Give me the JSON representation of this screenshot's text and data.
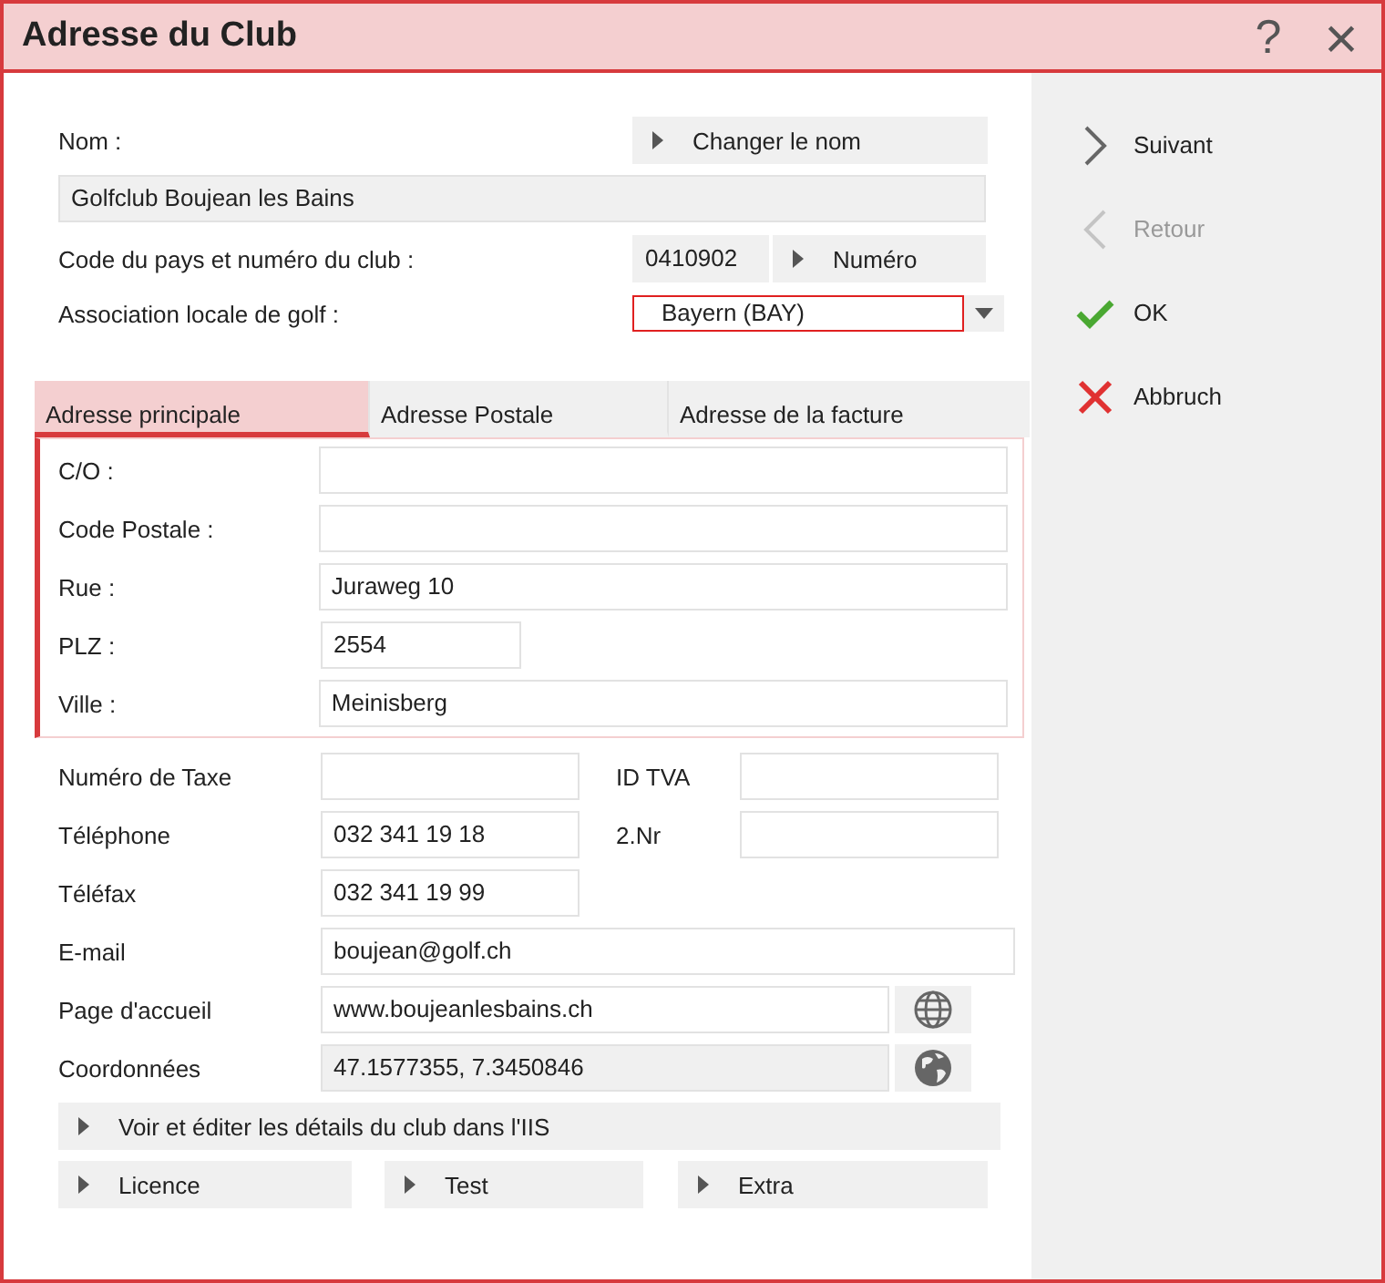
{
  "window": {
    "title": "Adresse du Club",
    "help": "?",
    "close": "×"
  },
  "name": {
    "label": "Nom :",
    "button": "Changer le nom",
    "value": "Golfclub Boujean les Bains"
  },
  "club_code": {
    "label": "Code du pays et numéro du club :",
    "value": "0410902",
    "button": "Numéro"
  },
  "association": {
    "label": "Association locale de golf :",
    "value": "Bayern (BAY)"
  },
  "tabs": [
    {
      "label": "Adresse principale",
      "selected": true
    },
    {
      "label": "Adresse Postale",
      "selected": false
    },
    {
      "label": "Adresse de la facture",
      "selected": false
    }
  ],
  "address_fields": [
    {
      "label": "C/O :",
      "kind": "wide"
    },
    {
      "label": "Code Postale :",
      "kind": "wide"
    },
    {
      "label": "Rue :",
      "value": "Juraweg 10",
      "kind": "wide"
    },
    {
      "label": "PLZ :",
      "value": "2554",
      "kind": "short"
    },
    {
      "label": "Ville :",
      "value": "Meinisberg",
      "kind": "wide"
    }
  ],
  "contact_rows": [
    {
      "fields": [
        {
          "label": "Numéro de Taxe",
          "kind": "short"
        },
        {
          "label": "ID TVA",
          "kind": "short"
        }
      ]
    },
    {
      "fields": [
        {
          "label": "Téléphone",
          "value": "032 341 19 18",
          "kind": "short"
        },
        {
          "label": "2.Nr",
          "kind": "short"
        }
      ]
    },
    {
      "fields": [
        {
          "label": "Téléfax",
          "value": "032 341 19 99",
          "kind": "short"
        }
      ]
    },
    {
      "fields": [
        {
          "label": "E-mail",
          "value": "boujean@golf.ch",
          "kind": "wide"
        }
      ]
    },
    {
      "fields": [
        {
          "label": "Page d'accueil",
          "value": "www.boujeanlesbains.ch",
          "kind": "web"
        }
      ]
    },
    {
      "fields": [
        {
          "label": "Coordonnées",
          "value": "47.1577355, 7.3450846",
          "kind": "geo"
        }
      ]
    }
  ],
  "iis_button": "Voir et éditer les détails du club dans l'IIS",
  "bottom_buttons": [
    "Licence",
    "Test",
    "Extra"
  ],
  "sidebar": [
    {
      "label": "Suivant",
      "kind": "next",
      "disabled": false
    },
    {
      "label": "Retour",
      "kind": "back",
      "disabled": true
    },
    {
      "label": "OK",
      "kind": "ok",
      "disabled": false
    },
    {
      "label": "Abbruch",
      "kind": "cancel",
      "disabled": false
    }
  ]
}
